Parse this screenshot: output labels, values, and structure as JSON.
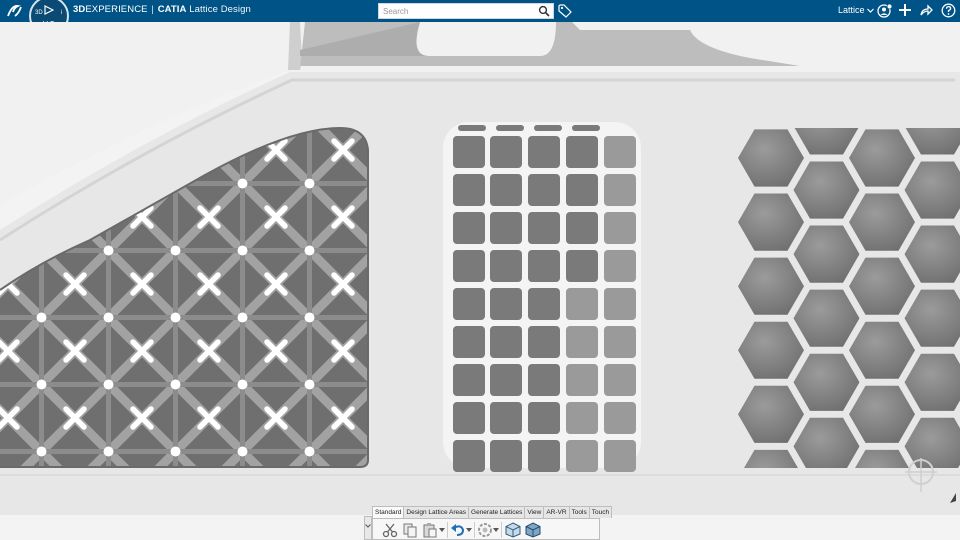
{
  "header": {
    "brand_part1": "3D",
    "brand_part2": "EXPERIENCE",
    "separator": "|",
    "brand_product": "CATIA",
    "app_title": "Lattice Design",
    "compass_label": "V,R",
    "compass_3d": "3D",
    "compass_i": "i",
    "search": {
      "placeholder": "Search",
      "value": ""
    },
    "active_app": "Lattice",
    "icons": [
      "ds-logo-icon",
      "compass-icon",
      "search-icon",
      "tag-icon",
      "user-icon",
      "plus-icon",
      "share-icon",
      "help-icon"
    ]
  },
  "action_bar": {
    "tabs": [
      {
        "label": "Standard",
        "active": true
      },
      {
        "label": "Design Lattice Areas",
        "active": false
      },
      {
        "label": "Generate Lattices",
        "active": false
      },
      {
        "label": "View",
        "active": false
      },
      {
        "label": "AR-VR",
        "active": false
      },
      {
        "label": "Tools",
        "active": false
      },
      {
        "label": "Touch",
        "active": false
      }
    ],
    "tools": [
      "cut-icon",
      "copy-icon",
      "paste-icon",
      "undo-icon",
      "update-icon",
      "part-view-icon",
      "render-view-icon"
    ]
  },
  "colors": {
    "topbar": "#005386",
    "lattice": "#8a8a8a",
    "part": "#e6e6e6"
  }
}
